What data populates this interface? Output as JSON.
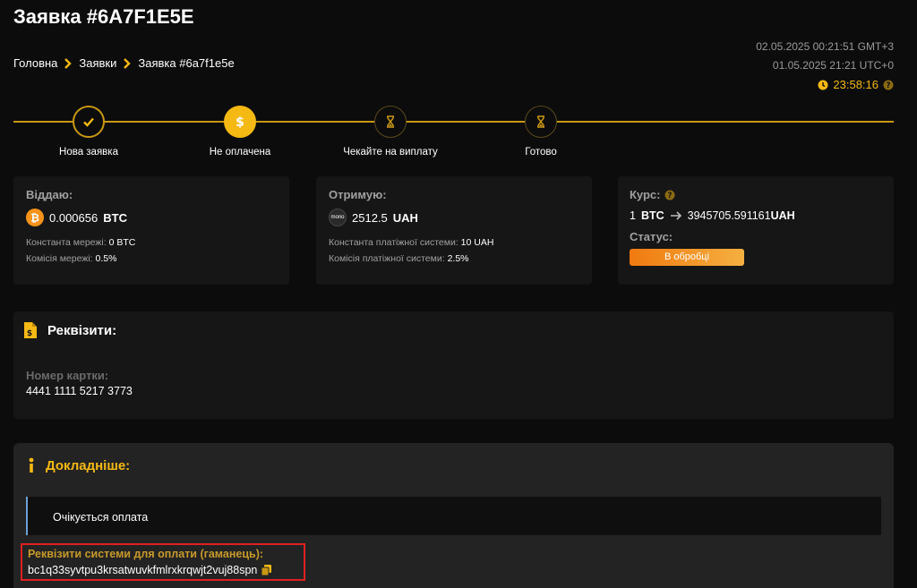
{
  "header": {
    "title": "Заявка #6A7F1E5E",
    "breadcrumb": [
      "Головна",
      "Заявки",
      "Заявка #6a7f1e5e"
    ],
    "time_local": "02.05.2025 00:21:51 GMT+3",
    "time_utc": "01.05.2025 21:21 UTC+0",
    "timer": "23:58:16"
  },
  "steps": [
    {
      "label": "Нова заявка",
      "icon": "check-icon"
    },
    {
      "label": "Не оплачена",
      "icon": "dollar-icon"
    },
    {
      "label": "Чекайте на виплату",
      "icon": "hourglass-icon"
    },
    {
      "label": "Готово",
      "icon": "hourglass-icon"
    }
  ],
  "give": {
    "title": "Віддаю:",
    "amount": "0.000656",
    "currency": "BTC",
    "const_label": "Константа мережі:",
    "const_value": "0 BTC",
    "fee_label": "Комісія мережі:",
    "fee_value": "0.5%"
  },
  "receive": {
    "title": "Отримую:",
    "logo_text": "mono",
    "amount": "2512.5",
    "currency": "UAH",
    "const_label": "Константа платіжної системи:",
    "const_value": "10 UAH",
    "fee_label": "Комісія платіжної системи:",
    "fee_value": "2.5%"
  },
  "rate": {
    "title": "Курс:",
    "from_amount": "1",
    "from_currency": "BTC",
    "to_amount": "3945705.591161",
    "to_currency": "UAH",
    "status_title": "Статус:",
    "status": "В обробці"
  },
  "requisites": {
    "title": "Реквізити:",
    "card_label": "Номер картки:",
    "card_number": "4441 1111 5217 3773"
  },
  "details": {
    "title": "Докладніше:",
    "notice": "Очікується оплата",
    "wallet_label": "Реквізити системи для оплати (гаманець):",
    "wallet_address": "bc1q33syvtpu3krsatwuvkfmlrxkrqwjt2vuj88spn"
  },
  "colors": {
    "accent": "#f5b914",
    "status_orange": "#f07a10",
    "highlight_red": "#e02020",
    "bitcoin": "#f7931a"
  }
}
